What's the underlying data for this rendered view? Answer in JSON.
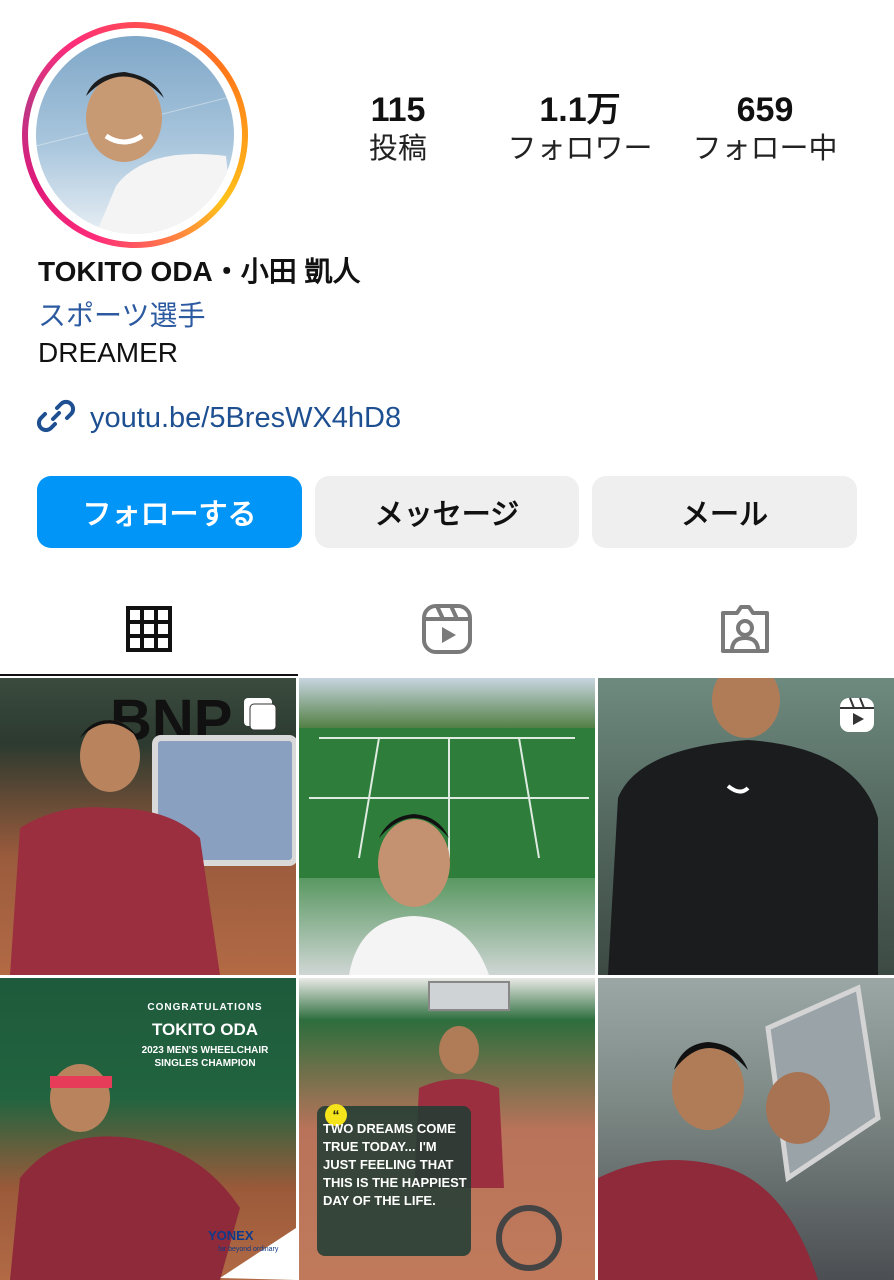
{
  "profile": {
    "stats": [
      {
        "value": "115",
        "label": "投稿"
      },
      {
        "value": "1.1万",
        "label": "フォロワー"
      },
      {
        "value": "659",
        "label": "フォロー中"
      }
    ],
    "name": "TOKITO ODA・小田 凱人",
    "category": "スポーツ選手",
    "bio": "DREAMER",
    "link": "youtu.be/5BresWX4hD8"
  },
  "buttons": {
    "follow": "フォローする",
    "message": "メッセージ",
    "mail": "メール"
  },
  "tabs": [
    {
      "icon": "grid-icon",
      "active": true
    },
    {
      "icon": "reels-icon",
      "active": false
    },
    {
      "icon": "tagged-icon",
      "active": false
    }
  ],
  "posts": {
    "p4": {
      "congrats": "CONGRATULATIONS",
      "name": "TOKITO ODA",
      "title": "2023 MEN'S WHEELCHAIR SINGLES CHAMPION",
      "brand": "YONEX",
      "tagline": "far beyond ordinary"
    },
    "p5": {
      "quote": "TWO DREAMS COME TRUE TODAY... I'M JUST FEELING THAT THIS IS THE HAPPIEST DAY OF THE LIFE."
    }
  },
  "colors": {
    "accent": "#0095f6",
    "link": "#1d4f91",
    "category": "#2c5aa0",
    "button_bg": "#efefef"
  }
}
